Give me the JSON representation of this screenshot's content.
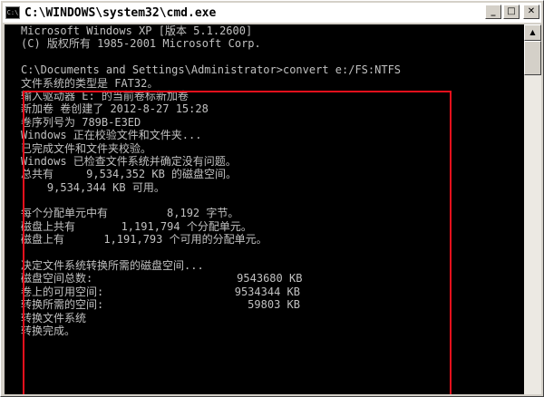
{
  "window": {
    "title": "C:\\WINDOWS\\system32\\cmd.exe",
    "icon_label": "C:\\",
    "controls": {
      "minimize": "_",
      "maximize": "□",
      "close": "✕"
    }
  },
  "console": {
    "lines": [
      "Microsoft Windows XP [版本 5.1.2600]",
      "(C) 版权所有 1985-2001 Microsoft Corp.",
      "",
      "C:\\Documents and Settings\\Administrator>convert e:/FS:NTFS",
      "文件系统的类型是 FAT32。",
      "输入驱动器 E: 的当前卷标新加卷",
      "新加卷 卷创建了 2012-8-27 15:28",
      "卷序列号为 789B-E3ED",
      "Windows 正在校验文件和文件夹...",
      "已完成文件和文件夹校验。",
      "Windows 已检查文件系统并确定没有问题。",
      "总共有     9,534,352 KB 的磁盘空间。",
      "    9,534,344 KB 可用。",
      "",
      "每个分配单元中有         8,192 字节。",
      "磁盘上共有       1,191,794 个分配单元。",
      "磁盘上有      1,191,793 个可用的分配单元。",
      "",
      "决定文件系统转换所需的磁盘空间...",
      "磁盘空间总数:                      9543680 KB",
      "卷上的可用空间:                    9534344 KB",
      "转换所需的空间:                      59803 KB",
      "转换文件系统",
      "转换完成。"
    ]
  },
  "scrollbar": {
    "up_arrow": "▲"
  },
  "colors": {
    "console_bg": "#000000",
    "console_text": "#c0c0c0",
    "highlight_border": "#e8101c"
  }
}
